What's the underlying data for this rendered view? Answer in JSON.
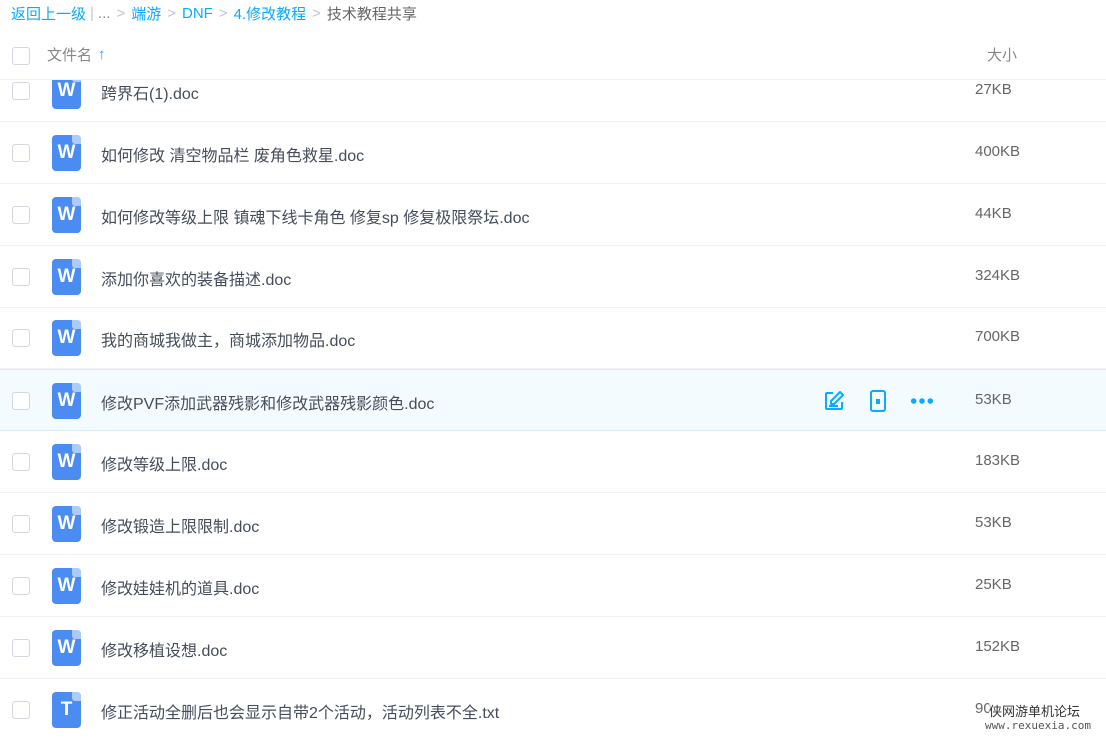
{
  "breadcrumb": {
    "back": "返回上一级",
    "separator_bar": "|",
    "ellipsis": "...",
    "items": [
      "端游",
      "DNF",
      "4.修改教程"
    ],
    "current": "技术教程共享",
    "arrow": ">"
  },
  "header": {
    "name_label": "文件名",
    "sort_icon": "↑",
    "size_label": "大小"
  },
  "files": [
    {
      "name": "跨界石(1).doc",
      "size": "27KB",
      "icon": "W",
      "type": "doc"
    },
    {
      "name": "如何修改 清空物品栏 废角色救星.doc",
      "size": "400KB",
      "icon": "W",
      "type": "doc"
    },
    {
      "name": "如何修改等级上限 镇魂下线卡角色 修复sp 修复极限祭坛.doc",
      "size": "44KB",
      "icon": "W",
      "type": "doc"
    },
    {
      "name": "添加你喜欢的装备描述.doc",
      "size": "324KB",
      "icon": "W",
      "type": "doc"
    },
    {
      "name": "我的商城我做主，商城添加物品.doc",
      "size": "700KB",
      "icon": "W",
      "type": "doc"
    },
    {
      "name": "修改PVF添加武器残影和修改武器残影颜色.doc",
      "size": "53KB",
      "icon": "W",
      "type": "doc"
    },
    {
      "name": "修改等级上限.doc",
      "size": "183KB",
      "icon": "W",
      "type": "doc"
    },
    {
      "name": "修改锻造上限限制.doc",
      "size": "53KB",
      "icon": "W",
      "type": "doc"
    },
    {
      "name": "修改娃娃机的道具.doc",
      "size": "25KB",
      "icon": "W",
      "type": "doc"
    },
    {
      "name": "修改移植设想.doc",
      "size": "152KB",
      "icon": "W",
      "type": "doc"
    },
    {
      "name": "修正活动全删后也会显示自带2个活动，活动列表不全.txt",
      "size": "90",
      "icon": "T",
      "type": "txt"
    }
  ],
  "row_actions": [
    "edit-icon",
    "phone-icon",
    "more-icon"
  ],
  "watermark": {
    "logo_text": "侠网游单机论坛",
    "url": "www.rexuexia.com"
  },
  "colors": {
    "accent": "#09aaff",
    "doc_icon": "#4a8cf2",
    "hover_row": "#f4fbff"
  }
}
